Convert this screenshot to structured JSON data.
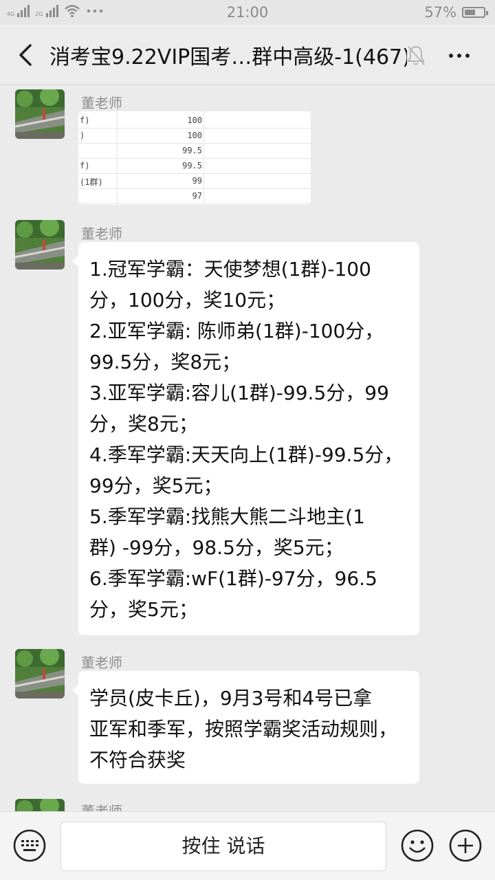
{
  "status_bar": {
    "signal1_label": "4G",
    "signal2_label": "2G",
    "time": "21:00",
    "battery_percent": "57%",
    "battery_level": 0.57
  },
  "header": {
    "title": "消考宝9.22VIP国考…群中高级-1(467)"
  },
  "messages": [
    {
      "sender": "董老师",
      "type": "image",
      "table_rows": [
        {
          "name": "f)",
          "score": "100"
        },
        {
          "name": ")",
          "score": "100"
        },
        {
          "name": "",
          "score": "99.5"
        },
        {
          "name": "f)",
          "score": "99.5"
        },
        {
          "name": "(1群)",
          "score": "99"
        },
        {
          "name": "",
          "score": "97"
        }
      ]
    },
    {
      "sender": "董老师",
      "type": "text",
      "lines": [
        "1.冠军学霸：天使梦想(1群)-100",
        "分，100分，奖10元；",
        "2.亚军学霸: 陈师弟(1群)-100分，",
        "99.5分，奖8元；",
        "3.亚军学霸:容儿(1群)-99.5分，99",
        "分，奖8元；",
        "4.季军学霸:天天向上(1群)-99.5分，",
        "99分，奖5元；",
        "5.季军学霸:找熊大熊二斗地主(1",
        "群) -99分，98.5分，奖5元；",
        "6.季军学霸:wF(1群)-97分，96.5",
        "分，奖5元；"
      ]
    },
    {
      "sender": "董老师",
      "type": "text",
      "lines": [
        "学员(皮卡丘)，9月3号和4号已拿",
        "亚军和季军，按照学霸奖活动规则，",
        "不符合获奖"
      ]
    },
    {
      "sender": "董老师",
      "type": "partial"
    }
  ],
  "input_bar": {
    "hold_to_talk": "按住 说话"
  }
}
